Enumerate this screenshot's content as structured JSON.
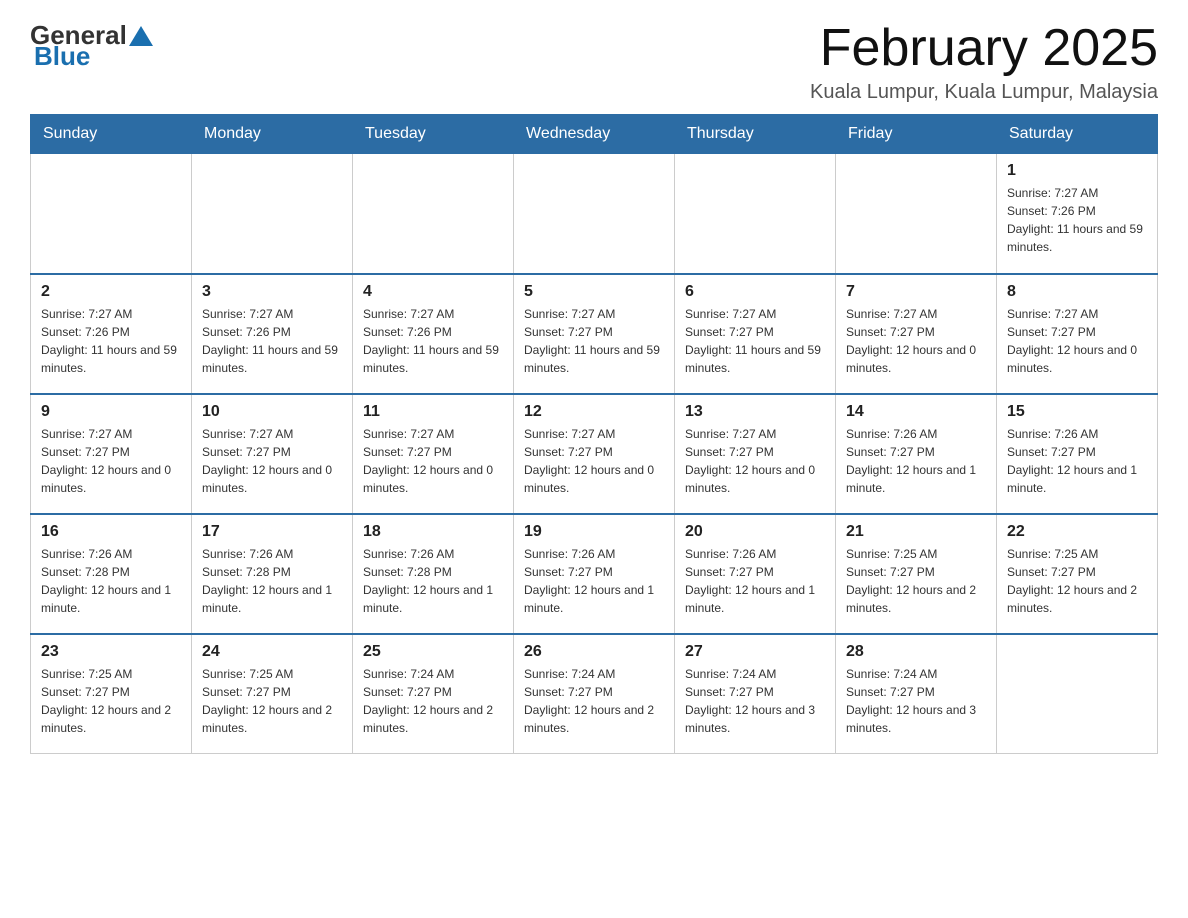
{
  "header": {
    "logo_general": "General",
    "logo_blue": "Blue",
    "month_title": "February 2025",
    "location": "Kuala Lumpur, Kuala Lumpur, Malaysia"
  },
  "days_of_week": [
    "Sunday",
    "Monday",
    "Tuesday",
    "Wednesday",
    "Thursday",
    "Friday",
    "Saturday"
  ],
  "weeks": [
    [
      {
        "day": "",
        "info": ""
      },
      {
        "day": "",
        "info": ""
      },
      {
        "day": "",
        "info": ""
      },
      {
        "day": "",
        "info": ""
      },
      {
        "day": "",
        "info": ""
      },
      {
        "day": "",
        "info": ""
      },
      {
        "day": "1",
        "info": "Sunrise: 7:27 AM\nSunset: 7:26 PM\nDaylight: 11 hours and 59 minutes."
      }
    ],
    [
      {
        "day": "2",
        "info": "Sunrise: 7:27 AM\nSunset: 7:26 PM\nDaylight: 11 hours and 59 minutes."
      },
      {
        "day": "3",
        "info": "Sunrise: 7:27 AM\nSunset: 7:26 PM\nDaylight: 11 hours and 59 minutes."
      },
      {
        "day": "4",
        "info": "Sunrise: 7:27 AM\nSunset: 7:26 PM\nDaylight: 11 hours and 59 minutes."
      },
      {
        "day": "5",
        "info": "Sunrise: 7:27 AM\nSunset: 7:27 PM\nDaylight: 11 hours and 59 minutes."
      },
      {
        "day": "6",
        "info": "Sunrise: 7:27 AM\nSunset: 7:27 PM\nDaylight: 11 hours and 59 minutes."
      },
      {
        "day": "7",
        "info": "Sunrise: 7:27 AM\nSunset: 7:27 PM\nDaylight: 12 hours and 0 minutes."
      },
      {
        "day": "8",
        "info": "Sunrise: 7:27 AM\nSunset: 7:27 PM\nDaylight: 12 hours and 0 minutes."
      }
    ],
    [
      {
        "day": "9",
        "info": "Sunrise: 7:27 AM\nSunset: 7:27 PM\nDaylight: 12 hours and 0 minutes."
      },
      {
        "day": "10",
        "info": "Sunrise: 7:27 AM\nSunset: 7:27 PM\nDaylight: 12 hours and 0 minutes."
      },
      {
        "day": "11",
        "info": "Sunrise: 7:27 AM\nSunset: 7:27 PM\nDaylight: 12 hours and 0 minutes."
      },
      {
        "day": "12",
        "info": "Sunrise: 7:27 AM\nSunset: 7:27 PM\nDaylight: 12 hours and 0 minutes."
      },
      {
        "day": "13",
        "info": "Sunrise: 7:27 AM\nSunset: 7:27 PM\nDaylight: 12 hours and 0 minutes."
      },
      {
        "day": "14",
        "info": "Sunrise: 7:26 AM\nSunset: 7:27 PM\nDaylight: 12 hours and 1 minute."
      },
      {
        "day": "15",
        "info": "Sunrise: 7:26 AM\nSunset: 7:27 PM\nDaylight: 12 hours and 1 minute."
      }
    ],
    [
      {
        "day": "16",
        "info": "Sunrise: 7:26 AM\nSunset: 7:28 PM\nDaylight: 12 hours and 1 minute."
      },
      {
        "day": "17",
        "info": "Sunrise: 7:26 AM\nSunset: 7:28 PM\nDaylight: 12 hours and 1 minute."
      },
      {
        "day": "18",
        "info": "Sunrise: 7:26 AM\nSunset: 7:28 PM\nDaylight: 12 hours and 1 minute."
      },
      {
        "day": "19",
        "info": "Sunrise: 7:26 AM\nSunset: 7:27 PM\nDaylight: 12 hours and 1 minute."
      },
      {
        "day": "20",
        "info": "Sunrise: 7:26 AM\nSunset: 7:27 PM\nDaylight: 12 hours and 1 minute."
      },
      {
        "day": "21",
        "info": "Sunrise: 7:25 AM\nSunset: 7:27 PM\nDaylight: 12 hours and 2 minutes."
      },
      {
        "day": "22",
        "info": "Sunrise: 7:25 AM\nSunset: 7:27 PM\nDaylight: 12 hours and 2 minutes."
      }
    ],
    [
      {
        "day": "23",
        "info": "Sunrise: 7:25 AM\nSunset: 7:27 PM\nDaylight: 12 hours and 2 minutes."
      },
      {
        "day": "24",
        "info": "Sunrise: 7:25 AM\nSunset: 7:27 PM\nDaylight: 12 hours and 2 minutes."
      },
      {
        "day": "25",
        "info": "Sunrise: 7:24 AM\nSunset: 7:27 PM\nDaylight: 12 hours and 2 minutes."
      },
      {
        "day": "26",
        "info": "Sunrise: 7:24 AM\nSunset: 7:27 PM\nDaylight: 12 hours and 2 minutes."
      },
      {
        "day": "27",
        "info": "Sunrise: 7:24 AM\nSunset: 7:27 PM\nDaylight: 12 hours and 3 minutes."
      },
      {
        "day": "28",
        "info": "Sunrise: 7:24 AM\nSunset: 7:27 PM\nDaylight: 12 hours and 3 minutes."
      },
      {
        "day": "",
        "info": ""
      }
    ]
  ]
}
